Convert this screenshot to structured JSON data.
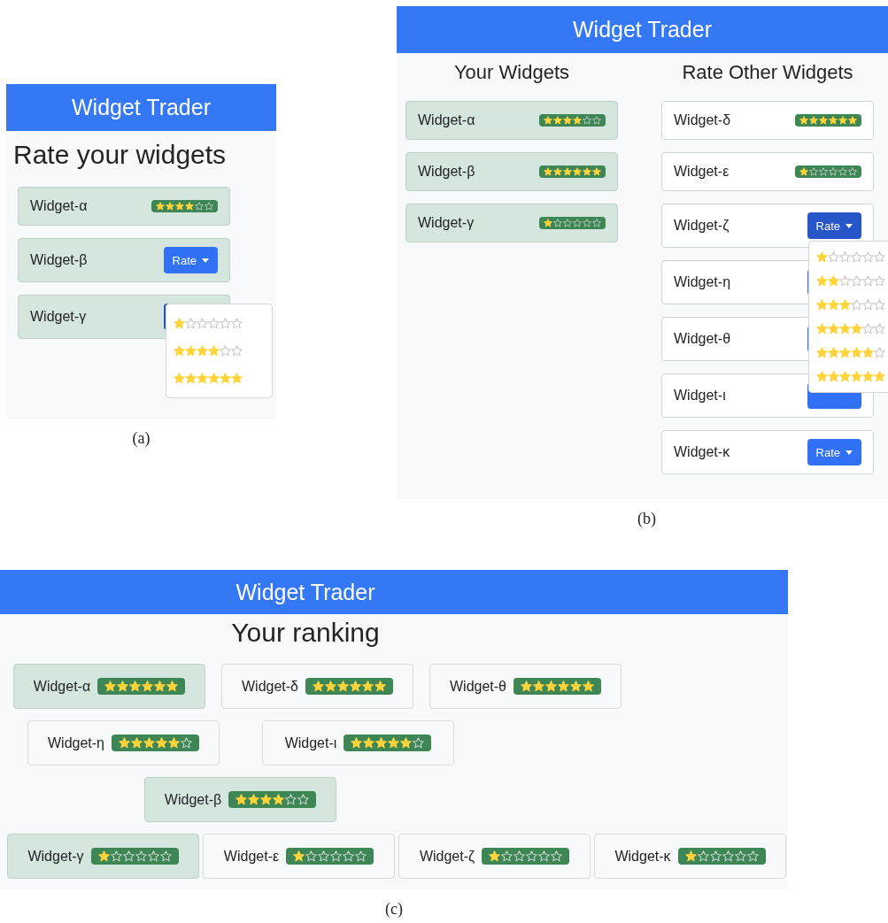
{
  "figure_a": {
    "header": "Widget Trader",
    "title": "Rate your widgets",
    "widgets": [
      {
        "name": "Widget-α",
        "owned": true,
        "kind": "rating",
        "stars": 4
      },
      {
        "name": "Widget-β",
        "owned": true,
        "kind": "button",
        "label": "Rate",
        "expanded": false
      },
      {
        "name": "Widget-γ",
        "owned": true,
        "kind": "button",
        "expanded": true,
        "menu": {
          "options": [
            {
              "stars": 1
            },
            {
              "stars": 4
            },
            {
              "stars": 6
            }
          ]
        }
      }
    ],
    "caption": "(a)"
  },
  "figure_b": {
    "header": "Widget Trader",
    "columns": [
      {
        "heading": "Your Widgets",
        "widgets": [
          {
            "name": "Widget-α",
            "owned": true,
            "kind": "rating",
            "stars": 4
          },
          {
            "name": "Widget-β",
            "owned": true,
            "kind": "rating",
            "stars": 6
          },
          {
            "name": "Widget-γ",
            "owned": true,
            "kind": "rating",
            "stars": 1
          }
        ]
      },
      {
        "heading": "Rate Other Widgets",
        "widgets": [
          {
            "name": "Widget-δ",
            "owned": false,
            "kind": "rating",
            "stars": 6
          },
          {
            "name": "Widget-ε",
            "owned": false,
            "kind": "rating",
            "stars": 1
          },
          {
            "name": "Widget-ζ",
            "owned": false,
            "kind": "button",
            "label": "Rate",
            "expanded": true,
            "menu": {
              "options": [
                {
                  "stars": 1
                },
                {
                  "stars": 2
                },
                {
                  "stars": 3
                },
                {
                  "stars": 4
                },
                {
                  "stars": 5
                },
                {
                  "stars": 6
                }
              ]
            }
          },
          {
            "name": "Widget-η",
            "owned": false,
            "kind": "button",
            "expanded": false
          },
          {
            "name": "Widget-θ",
            "owned": false,
            "kind": "button",
            "expanded": false
          },
          {
            "name": "Widget-ι",
            "owned": false,
            "kind": "button",
            "expanded": false
          },
          {
            "name": "Widget-κ",
            "owned": false,
            "kind": "button",
            "label": "Rate",
            "expanded": false
          }
        ]
      }
    ],
    "caption": "(b)"
  },
  "figure_c": {
    "header": "Widget Trader",
    "title": "Your ranking",
    "rows": [
      [
        {
          "name": "Widget-α",
          "owned": true,
          "stars": 6
        },
        {
          "name": "Widget-δ",
          "owned": false,
          "stars": 6
        },
        {
          "name": "Widget-θ",
          "owned": false,
          "stars": 6
        }
      ],
      [
        {
          "name": "Widget-η",
          "owned": false,
          "stars": 5
        },
        {
          "name": "Widget-ι",
          "owned": false,
          "stars": 5
        }
      ],
      [
        {
          "name": "Widget-β",
          "owned": true,
          "stars": 4
        }
      ],
      [
        {
          "name": "Widget-γ",
          "owned": true,
          "stars": 1
        },
        {
          "name": "Widget-ε",
          "owned": false,
          "stars": 1
        },
        {
          "name": "Widget-ζ",
          "owned": false,
          "stars": 1
        },
        {
          "name": "Widget-κ",
          "owned": false,
          "stars": 1
        }
      ]
    ],
    "caption": "(c)"
  }
}
